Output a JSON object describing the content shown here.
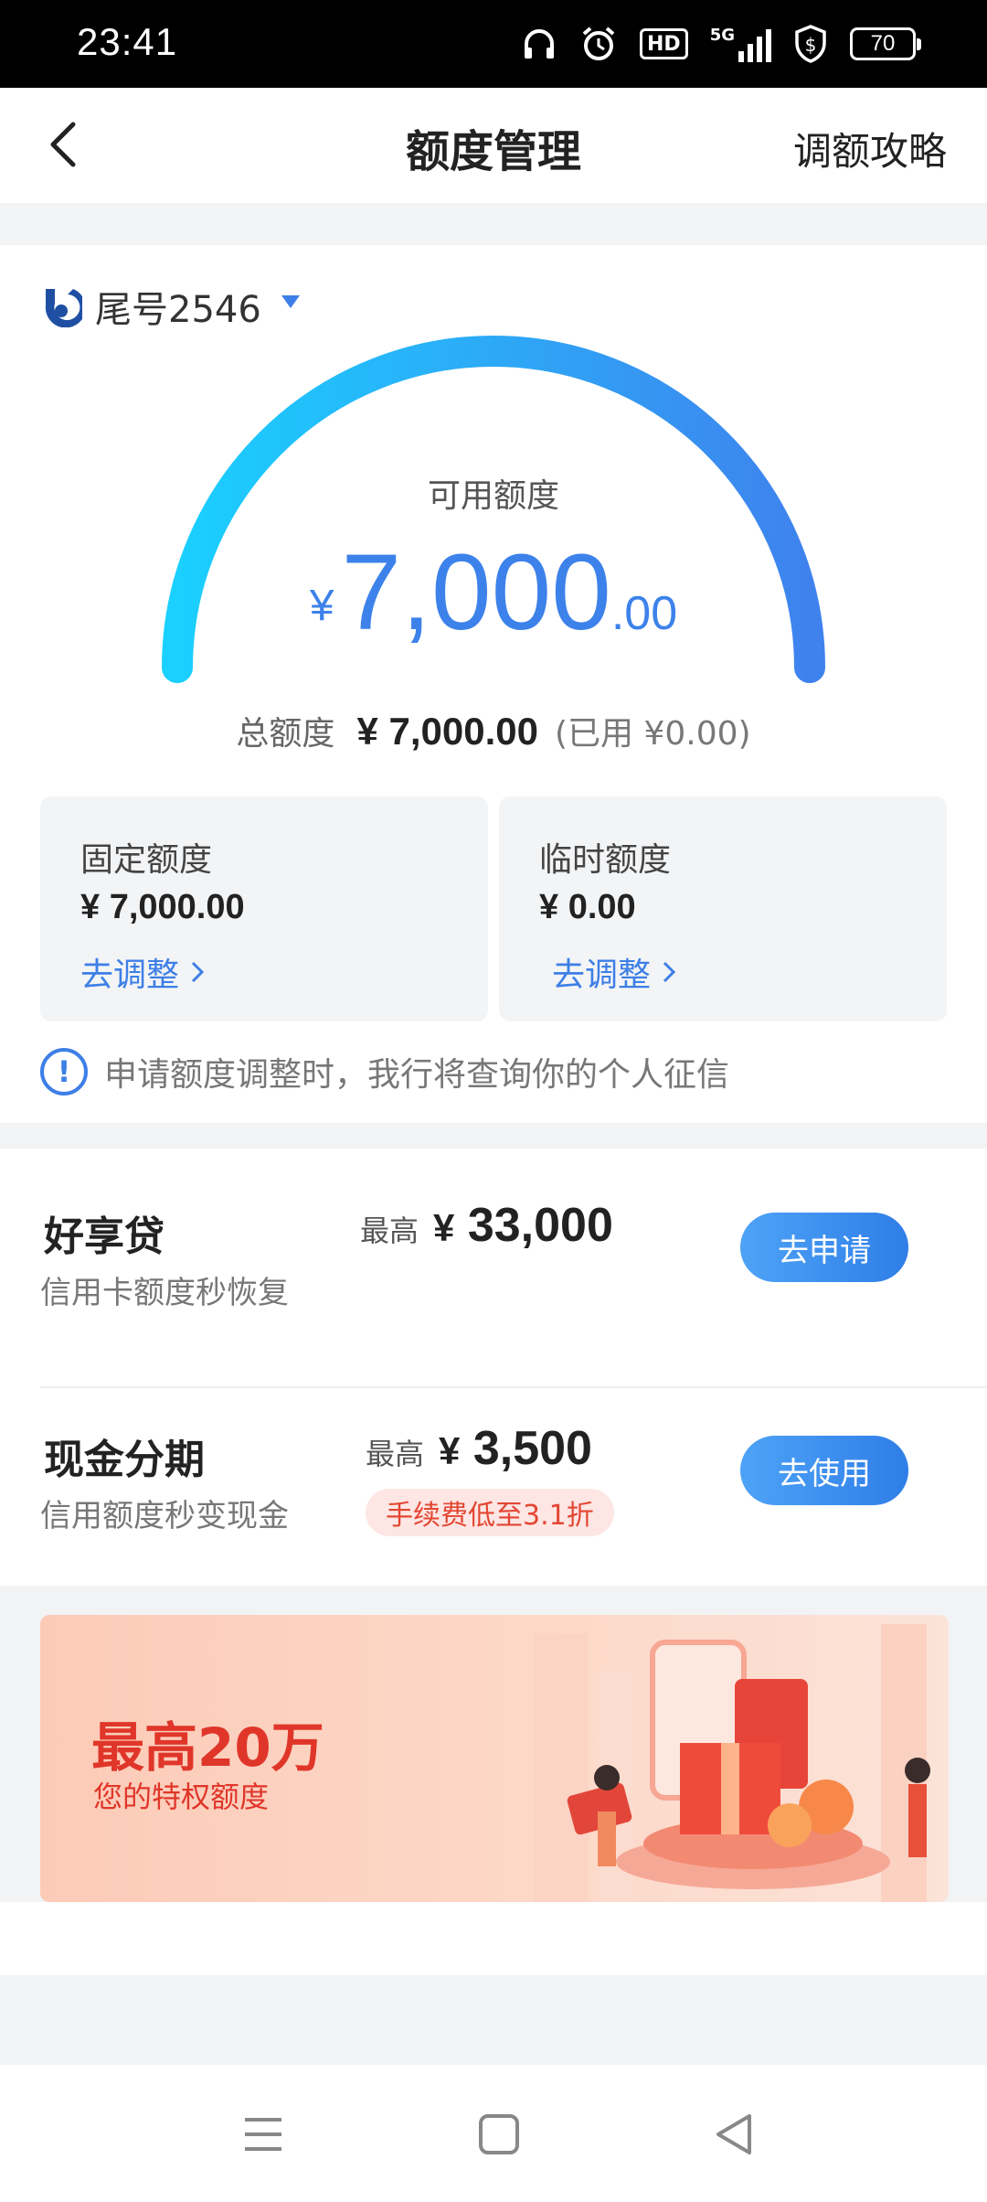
{
  "status_bar": {
    "time": "23:41",
    "hd_label": "HD",
    "net_label": "5G",
    "battery": "70"
  },
  "header": {
    "title": "额度管理",
    "right_link": "调额攻略"
  },
  "account": {
    "label": "尾号2546"
  },
  "available": {
    "label": "可用额度",
    "currency": "¥",
    "integer": "7,000",
    "decimal": ".00"
  },
  "total": {
    "label": "总额度",
    "value": "¥ 7,000.00",
    "used": "(已用 ¥0.00)"
  },
  "fixed": {
    "label": "固定额度",
    "amount": "¥ 7,000.00",
    "action": "去调整"
  },
  "temporary": {
    "label": "临时额度",
    "amount": "¥ 0.00",
    "action": "去调整"
  },
  "notice": {
    "text": "申请额度调整时，我行将查询你的个人征信"
  },
  "products": [
    {
      "name": "好享贷",
      "desc": "信用卡额度秒恢复",
      "max_label": "最高",
      "currency": "¥",
      "amount": "33,000",
      "button": "去申请"
    },
    {
      "name": "现金分期",
      "desc": "信用额度秒变现金",
      "max_label": "最高",
      "currency": "¥",
      "amount": "3,500",
      "tag": "手续费低至3.1折",
      "button": "去使用"
    }
  ],
  "banner": {
    "headline": "最高20万",
    "subline": "您的特权额度"
  },
  "colors": {
    "accent": "#3d7fe6",
    "gauge_start": "#1ad0ff",
    "gauge_end": "#3f82ee",
    "promo_red": "#e0362a"
  },
  "icons": [
    "back-arrow-icon",
    "bank-logo-icon",
    "dropdown-caret-icon",
    "chevron-right-icon",
    "info-icon",
    "menu-nav-icon",
    "home-nav-icon",
    "back-nav-icon"
  ]
}
